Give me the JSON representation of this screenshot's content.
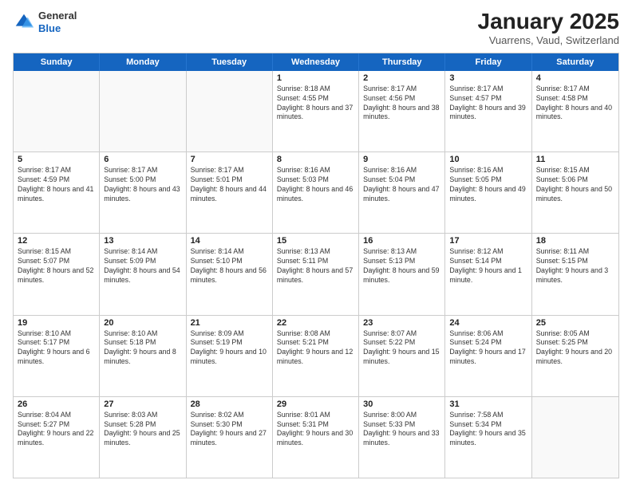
{
  "logo": {
    "general": "General",
    "blue": "Blue"
  },
  "title": "January 2025",
  "location": "Vuarrens, Vaud, Switzerland",
  "header": {
    "days": [
      "Sunday",
      "Monday",
      "Tuesday",
      "Wednesday",
      "Thursday",
      "Friday",
      "Saturday"
    ]
  },
  "weeks": [
    [
      {
        "day": "",
        "info": ""
      },
      {
        "day": "",
        "info": ""
      },
      {
        "day": "",
        "info": ""
      },
      {
        "day": "1",
        "info": "Sunrise: 8:18 AM\nSunset: 4:55 PM\nDaylight: 8 hours and 37 minutes."
      },
      {
        "day": "2",
        "info": "Sunrise: 8:17 AM\nSunset: 4:56 PM\nDaylight: 8 hours and 38 minutes."
      },
      {
        "day": "3",
        "info": "Sunrise: 8:17 AM\nSunset: 4:57 PM\nDaylight: 8 hours and 39 minutes."
      },
      {
        "day": "4",
        "info": "Sunrise: 8:17 AM\nSunset: 4:58 PM\nDaylight: 8 hours and 40 minutes."
      }
    ],
    [
      {
        "day": "5",
        "info": "Sunrise: 8:17 AM\nSunset: 4:59 PM\nDaylight: 8 hours and 41 minutes."
      },
      {
        "day": "6",
        "info": "Sunrise: 8:17 AM\nSunset: 5:00 PM\nDaylight: 8 hours and 43 minutes."
      },
      {
        "day": "7",
        "info": "Sunrise: 8:17 AM\nSunset: 5:01 PM\nDaylight: 8 hours and 44 minutes."
      },
      {
        "day": "8",
        "info": "Sunrise: 8:16 AM\nSunset: 5:03 PM\nDaylight: 8 hours and 46 minutes."
      },
      {
        "day": "9",
        "info": "Sunrise: 8:16 AM\nSunset: 5:04 PM\nDaylight: 8 hours and 47 minutes."
      },
      {
        "day": "10",
        "info": "Sunrise: 8:16 AM\nSunset: 5:05 PM\nDaylight: 8 hours and 49 minutes."
      },
      {
        "day": "11",
        "info": "Sunrise: 8:15 AM\nSunset: 5:06 PM\nDaylight: 8 hours and 50 minutes."
      }
    ],
    [
      {
        "day": "12",
        "info": "Sunrise: 8:15 AM\nSunset: 5:07 PM\nDaylight: 8 hours and 52 minutes."
      },
      {
        "day": "13",
        "info": "Sunrise: 8:14 AM\nSunset: 5:09 PM\nDaylight: 8 hours and 54 minutes."
      },
      {
        "day": "14",
        "info": "Sunrise: 8:14 AM\nSunset: 5:10 PM\nDaylight: 8 hours and 56 minutes."
      },
      {
        "day": "15",
        "info": "Sunrise: 8:13 AM\nSunset: 5:11 PM\nDaylight: 8 hours and 57 minutes."
      },
      {
        "day": "16",
        "info": "Sunrise: 8:13 AM\nSunset: 5:13 PM\nDaylight: 8 hours and 59 minutes."
      },
      {
        "day": "17",
        "info": "Sunrise: 8:12 AM\nSunset: 5:14 PM\nDaylight: 9 hours and 1 minute."
      },
      {
        "day": "18",
        "info": "Sunrise: 8:11 AM\nSunset: 5:15 PM\nDaylight: 9 hours and 3 minutes."
      }
    ],
    [
      {
        "day": "19",
        "info": "Sunrise: 8:10 AM\nSunset: 5:17 PM\nDaylight: 9 hours and 6 minutes."
      },
      {
        "day": "20",
        "info": "Sunrise: 8:10 AM\nSunset: 5:18 PM\nDaylight: 9 hours and 8 minutes."
      },
      {
        "day": "21",
        "info": "Sunrise: 8:09 AM\nSunset: 5:19 PM\nDaylight: 9 hours and 10 minutes."
      },
      {
        "day": "22",
        "info": "Sunrise: 8:08 AM\nSunset: 5:21 PM\nDaylight: 9 hours and 12 minutes."
      },
      {
        "day": "23",
        "info": "Sunrise: 8:07 AM\nSunset: 5:22 PM\nDaylight: 9 hours and 15 minutes."
      },
      {
        "day": "24",
        "info": "Sunrise: 8:06 AM\nSunset: 5:24 PM\nDaylight: 9 hours and 17 minutes."
      },
      {
        "day": "25",
        "info": "Sunrise: 8:05 AM\nSunset: 5:25 PM\nDaylight: 9 hours and 20 minutes."
      }
    ],
    [
      {
        "day": "26",
        "info": "Sunrise: 8:04 AM\nSunset: 5:27 PM\nDaylight: 9 hours and 22 minutes."
      },
      {
        "day": "27",
        "info": "Sunrise: 8:03 AM\nSunset: 5:28 PM\nDaylight: 9 hours and 25 minutes."
      },
      {
        "day": "28",
        "info": "Sunrise: 8:02 AM\nSunset: 5:30 PM\nDaylight: 9 hours and 27 minutes."
      },
      {
        "day": "29",
        "info": "Sunrise: 8:01 AM\nSunset: 5:31 PM\nDaylight: 9 hours and 30 minutes."
      },
      {
        "day": "30",
        "info": "Sunrise: 8:00 AM\nSunset: 5:33 PM\nDaylight: 9 hours and 33 minutes."
      },
      {
        "day": "31",
        "info": "Sunrise: 7:58 AM\nSunset: 5:34 PM\nDaylight: 9 hours and 35 minutes."
      },
      {
        "day": "",
        "info": ""
      }
    ]
  ]
}
